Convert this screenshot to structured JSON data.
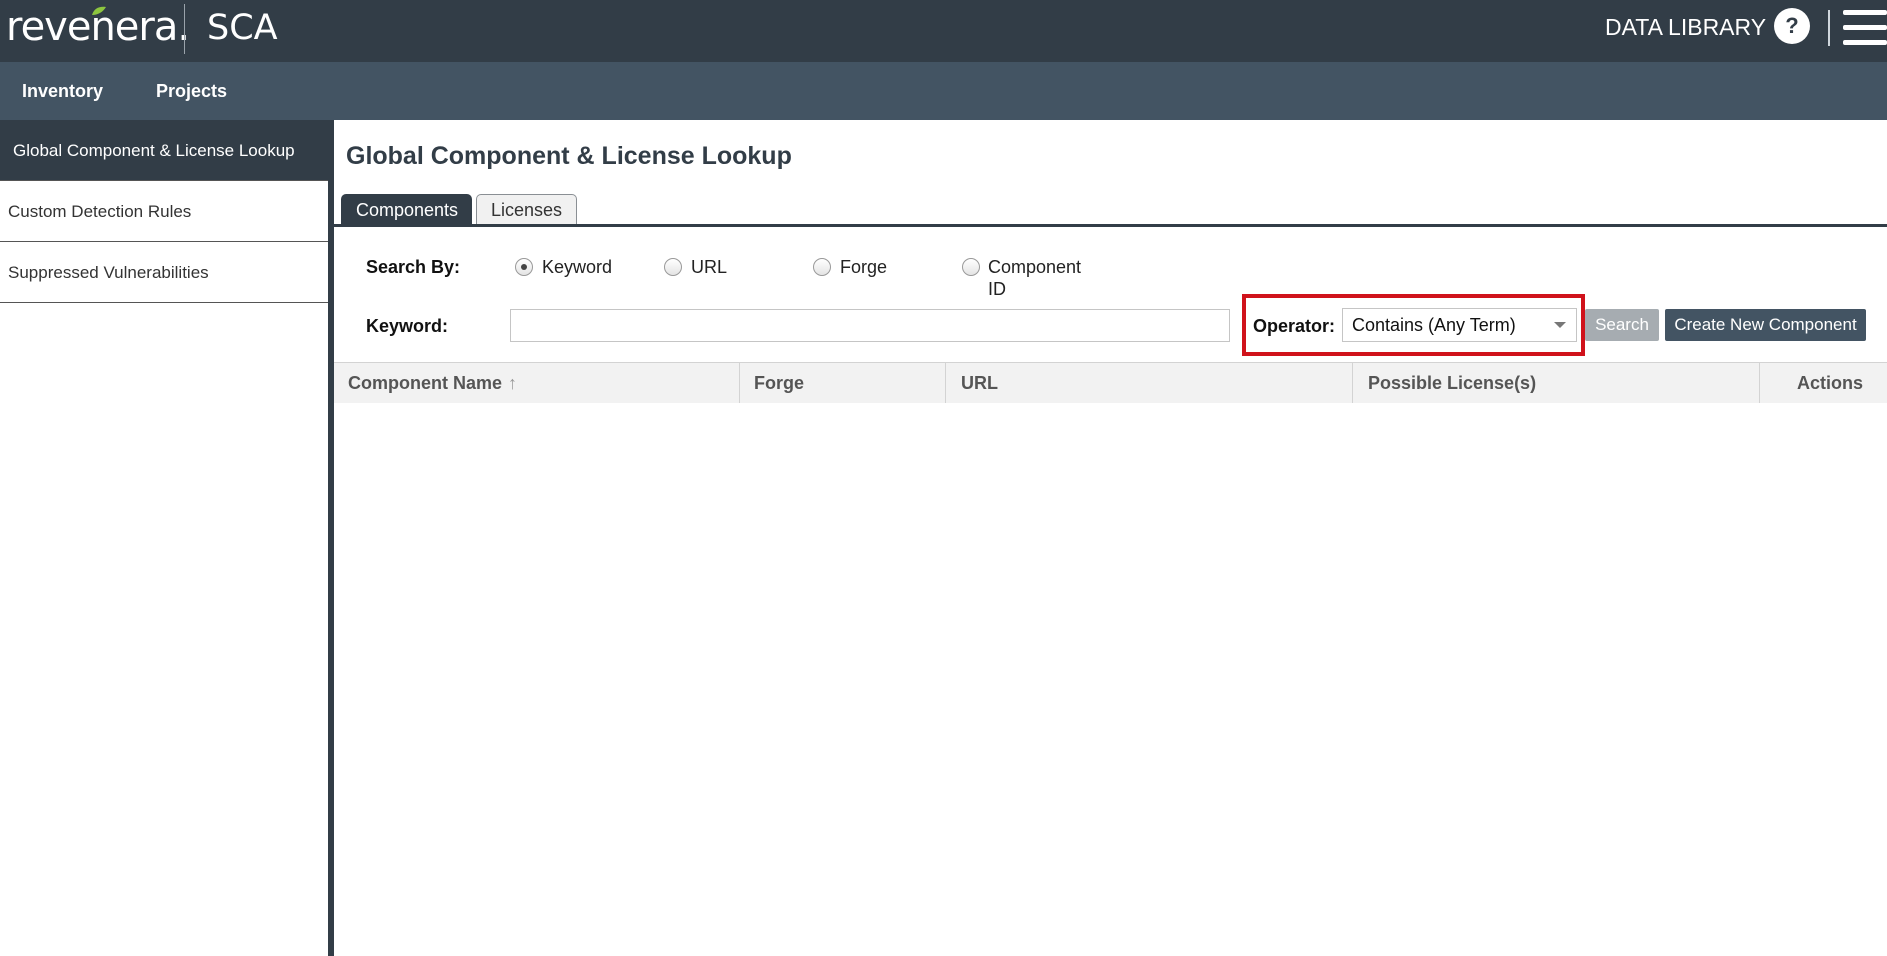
{
  "header": {
    "logo_text": "revenera.",
    "product": "SCA",
    "section": "DATA LIBRARY",
    "help_label": "?"
  },
  "nav": {
    "items": [
      {
        "label": "Inventory"
      },
      {
        "label": "Projects"
      }
    ]
  },
  "sidebar": {
    "items": [
      {
        "label": "Global Component & License Lookup",
        "active": true
      },
      {
        "label": "Custom Detection Rules",
        "active": false
      },
      {
        "label": "Suppressed Vulnerabilities",
        "active": false
      }
    ]
  },
  "main": {
    "title": "Global Component & License Lookup",
    "tabs": [
      {
        "label": "Components",
        "active": true
      },
      {
        "label": "Licenses",
        "active": false
      }
    ],
    "search_by_label": "Search By:",
    "radios": [
      {
        "label": "Keyword",
        "checked": true
      },
      {
        "label": "URL",
        "checked": false
      },
      {
        "label": "Forge",
        "checked": false
      },
      {
        "label_line1": "Component",
        "label_line2": "ID",
        "checked": false
      }
    ],
    "keyword_label": "Keyword:",
    "keyword_value": "",
    "operator_label": "Operator:",
    "operator_value": "Contains (Any Term)",
    "search_button": "Search",
    "create_button": "Create New Component",
    "columns": [
      {
        "label": "Component Name"
      },
      {
        "label": "Forge"
      },
      {
        "label": "URL"
      },
      {
        "label": "Possible License(s)"
      },
      {
        "label": "Actions"
      }
    ]
  },
  "colors": {
    "header_bg": "#323d47",
    "nav_bg": "#435463",
    "highlight": "#d0121b",
    "logo_leaf": "#8dc63f"
  }
}
